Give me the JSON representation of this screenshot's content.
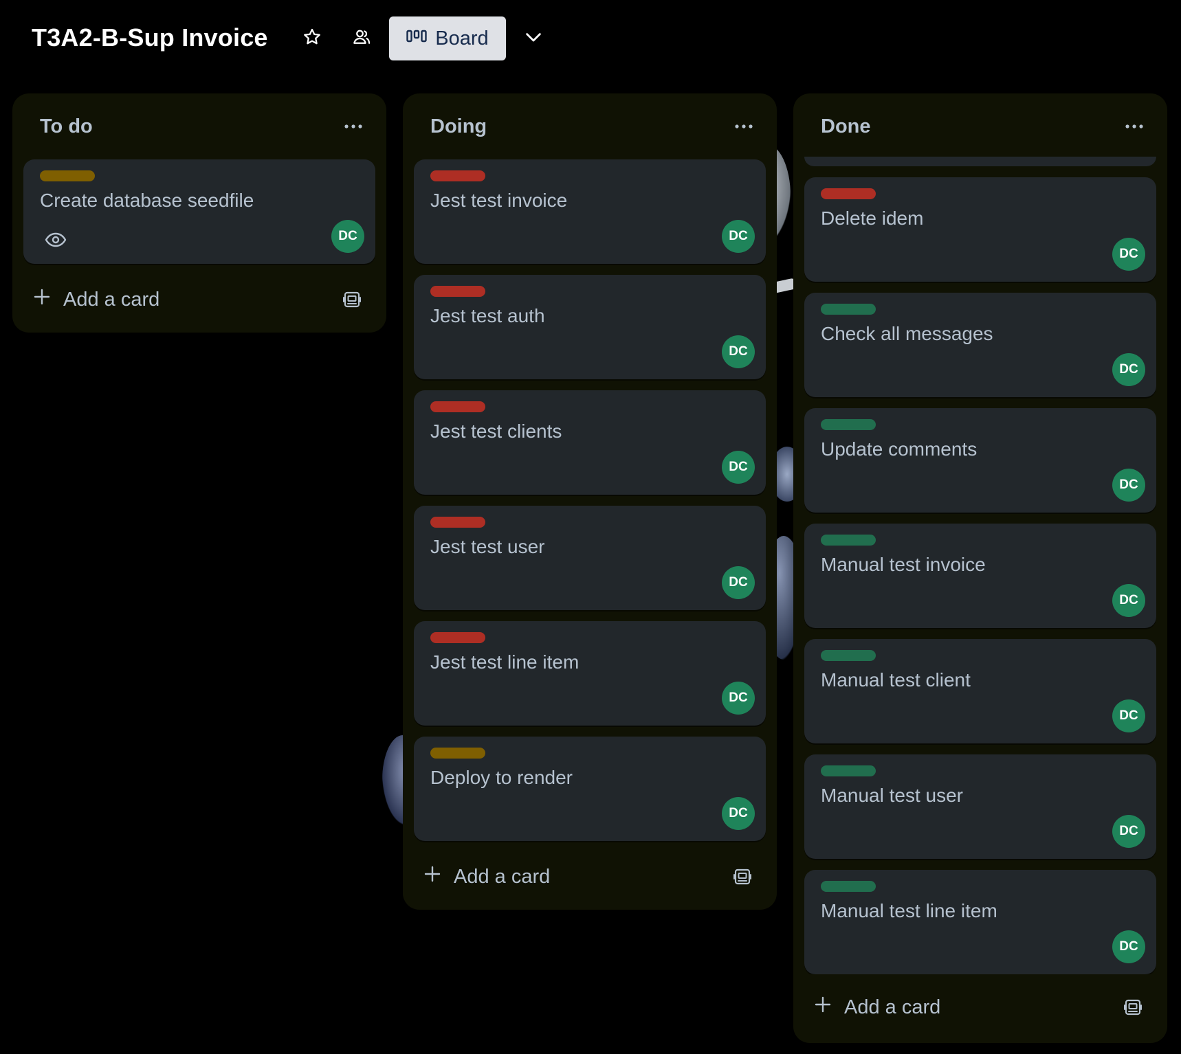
{
  "header": {
    "board_title": "T3A2-B-Sup Invoice",
    "view_label": "Board"
  },
  "colors": {
    "list_bg": "#101204",
    "card_bg": "#22272b",
    "label_yellow": "#7f5f01",
    "label_red": "#ae2e24",
    "label_green": "#216e4e",
    "avatar_bg": "#1f845a"
  },
  "lists": [
    {
      "title": "To do",
      "add_card_label": "Add a card",
      "cards": [
        {
          "title": "Create database seedfile",
          "label_color": "yellow",
          "avatar": "DC",
          "has_watch": true
        }
      ]
    },
    {
      "title": "Doing",
      "add_card_label": "Add a card",
      "cards": [
        {
          "title": "Jest test invoice",
          "label_color": "red",
          "avatar": "DC"
        },
        {
          "title": "Jest test auth",
          "label_color": "red",
          "avatar": "DC"
        },
        {
          "title": "Jest test clients",
          "label_color": "red",
          "avatar": "DC"
        },
        {
          "title": "Jest test user",
          "label_color": "red",
          "avatar": "DC"
        },
        {
          "title": "Jest test line item",
          "label_color": "red",
          "avatar": "DC"
        },
        {
          "title": "Deploy to render",
          "label_color": "yellow",
          "avatar": "DC"
        }
      ]
    },
    {
      "title": "Done",
      "add_card_label": "Add a card",
      "cards": [
        {
          "title": "Delete idem",
          "label_color": "red",
          "avatar": "DC"
        },
        {
          "title": "Check all messages",
          "label_color": "green",
          "avatar": "DC"
        },
        {
          "title": "Update comments",
          "label_color": "green",
          "avatar": "DC"
        },
        {
          "title": "Manual test invoice",
          "label_color": "green",
          "avatar": "DC"
        },
        {
          "title": "Manual test client",
          "label_color": "green",
          "avatar": "DC"
        },
        {
          "title": "Manual test user",
          "label_color": "green",
          "avatar": "DC"
        },
        {
          "title": "Manual test line item",
          "label_color": "green",
          "avatar": "DC"
        }
      ]
    }
  ]
}
